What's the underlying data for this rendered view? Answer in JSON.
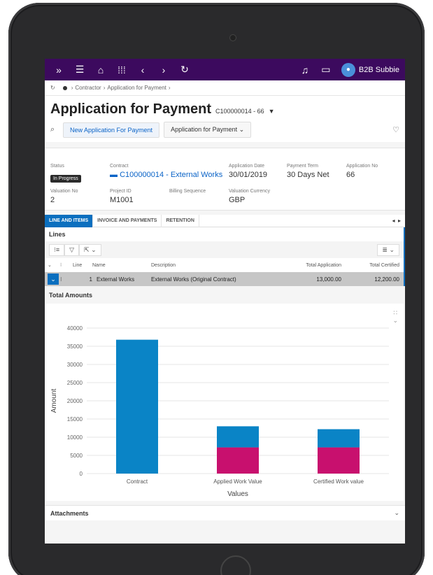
{
  "topbar": {
    "icons": [
      "expand-icon",
      "menu-icon",
      "home-icon",
      "apps-icon",
      "back-icon",
      "forward-icon",
      "refresh-icon",
      "bell-icon",
      "cart-icon"
    ],
    "user_name": "B2B Subbie"
  },
  "breadcrumb": {
    "items": [
      "Contractor",
      "Application for Payment"
    ]
  },
  "header": {
    "title": "Application for Payment",
    "record_id": "C100000014 - 66",
    "new_button": "New Application For Payment",
    "dropdown_button": "Application for Payment"
  },
  "info": {
    "status_label": "Status",
    "status_value": "In Progress",
    "contract_label": "Contract",
    "contract_value": "C100000014 - External Works",
    "app_date_label": "Application Date",
    "app_date_value": "30/01/2019",
    "payment_term_label": "Payment Term",
    "payment_term_value": "30 Days Net",
    "app_no_label": "Application No",
    "app_no_value": "66",
    "valuation_no_label": "Valuation No",
    "valuation_no_value": "2",
    "project_label": "Project ID",
    "project_value": "M1001",
    "billing_label": "Billing Sequence",
    "billing_value": "",
    "currency_label": "Valuation Currency",
    "currency_value": "GBP"
  },
  "tabs": [
    "LINE AND ITEMS",
    "INVOICE AND PAYMENTS",
    "RETENTION"
  ],
  "lines": {
    "title": "Lines",
    "columns": [
      "",
      "",
      "Line",
      "Name",
      "Description",
      "Total Application",
      "Total Certified"
    ],
    "rows": [
      {
        "line": "1",
        "name": "External Works",
        "description": "External Works (Original Contract)",
        "total_application": "13,000.00",
        "total_certified": "12,200.00"
      }
    ]
  },
  "totals_title": "Total Amounts",
  "chart_data": {
    "type": "bar",
    "stacked": true,
    "categories": [
      "Contract",
      "Applied Work Value",
      "Certified Work value"
    ],
    "series": [
      {
        "name": "",
        "color": "#c8106e",
        "values": [
          0,
          7200,
          7200
        ]
      },
      {
        "name": "",
        "color": "#0a84c6",
        "values": [
          36800,
          5800,
          5000
        ]
      }
    ],
    "xlabel": "Values",
    "ylabel": "Amount",
    "ylim": [
      0,
      40000
    ],
    "yticks": [
      0,
      5000,
      10000,
      15000,
      20000,
      25000,
      30000,
      35000,
      40000
    ],
    "grid": true
  },
  "attachments": {
    "label": "Attachments"
  }
}
